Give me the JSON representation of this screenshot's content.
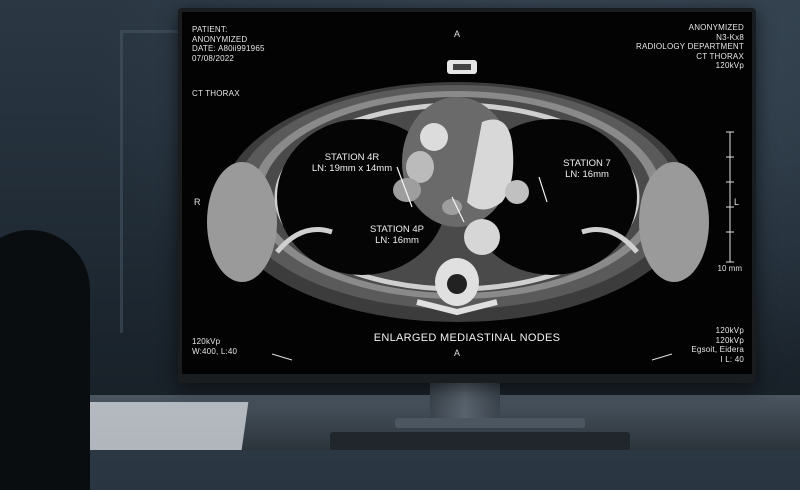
{
  "screen": {
    "header_left": [
      "PATIENT:",
      "ANONYMIZED",
      "DATE: A80ii991965",
      "07/08/2022"
    ],
    "exam_left": "CT THORAX",
    "header_right": [
      "ANONYMIZED",
      "N3-Kx8",
      "RADIOLOGY DEPARTMENT",
      "CT THORAX",
      "120kVp"
    ],
    "footer_left": [
      "120kVp",
      "W:400, L:40"
    ],
    "footer_right": [
      "120kVp",
      "120kVp",
      "Egsoit, Eidera",
      "I L: 40"
    ],
    "orientation": {
      "top": "A",
      "bottom": "A",
      "left": "R",
      "right": "L"
    },
    "scale": "10 mm",
    "caption": "ENLARGED MEDIASTINAL NODES",
    "annotations": {
      "station_4r": {
        "title": "STATION 4R",
        "measure": "LN: 19mm x 14mm"
      },
      "station_7": {
        "title": "STATION 7",
        "measure": "LN: 16mm"
      },
      "station_4p": {
        "title": "STATION 4P",
        "measure": "LN: 16mm"
      }
    }
  }
}
